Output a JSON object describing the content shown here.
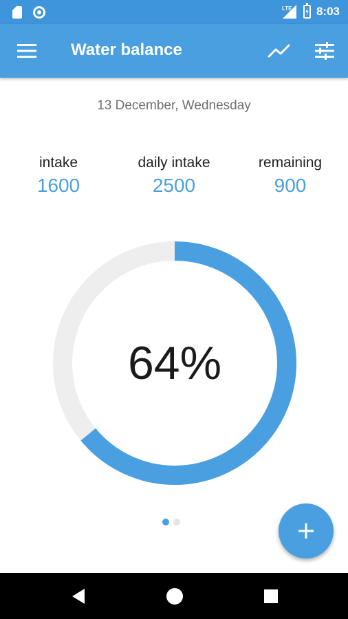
{
  "status_bar": {
    "time": "8:03",
    "network": "LTE",
    "icons": [
      "sim-card-icon",
      "ring-notification-icon",
      "lte-signal-icon",
      "battery-charging-icon"
    ]
  },
  "app_bar": {
    "title": "Water balance",
    "menu_icon": "hamburger-menu-icon",
    "actions": [
      "statistics-chart-icon",
      "settings-sliders-icon"
    ]
  },
  "date": "13 December, Wednesday",
  "stats": {
    "intake": {
      "label": "intake",
      "value": "1600"
    },
    "daily_intake": {
      "label": "daily intake",
      "value": "2500"
    },
    "remaining": {
      "label": "remaining",
      "value": "900"
    }
  },
  "progress": {
    "percent_text": "64%",
    "fraction": 0.64,
    "fill_color": "#4a9fe0",
    "track_color": "#eeeeee"
  },
  "pager": {
    "count": 2,
    "active": 0
  },
  "fab": {
    "icon": "add-icon"
  },
  "nav_bar": {
    "icons": [
      "back-icon",
      "home-icon",
      "recents-icon"
    ]
  },
  "colors": {
    "primary": "#4a9fe0",
    "status_bar": "#3f95db"
  }
}
